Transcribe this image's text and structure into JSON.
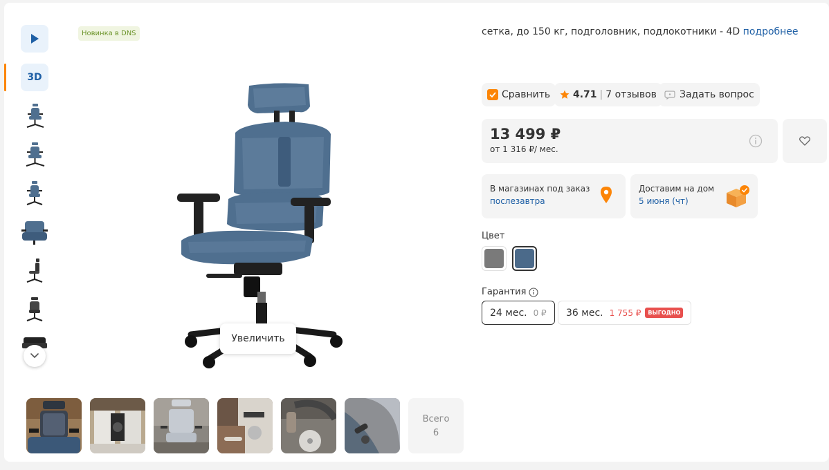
{
  "badge": {
    "new": "Новинка в DNS"
  },
  "thumbnails": {
    "video_icon": "play-icon",
    "label_3d": "3D",
    "images": [
      "chair-front",
      "chair-angle-left",
      "chair-side-front",
      "chair-seat-closeup",
      "chair-profile",
      "chair-back",
      "chair-base"
    ]
  },
  "main_image": {
    "zoom_label": "Увеличить"
  },
  "photos": {
    "items": [
      "user-photo-1",
      "user-photo-2",
      "user-photo-3",
      "user-photo-4",
      "user-photo-5",
      "user-photo-6"
    ],
    "all_label": "Всего",
    "all_count": "6"
  },
  "specs": {
    "text": "сетка, до 150 кг, подголовник, подлокотники - 4D",
    "more_link": "подробнее"
  },
  "actions": {
    "compare_label": "Сравнить",
    "rating": "4.71",
    "separator": "|",
    "reviews": "7 отзывов",
    "ask_label": "Задать вопрос"
  },
  "price": {
    "value": "13 499 ₽",
    "credit": "от 1 316 ₽/ мес."
  },
  "availability": {
    "store_title": "В магазинах под заказ",
    "store_when": "послезавтра",
    "delivery_title": "Доставим на дом",
    "delivery_when": "5 июня (чт)"
  },
  "color": {
    "label": "Цвет",
    "options": [
      {
        "name": "grey",
        "hex": "#7a7a7a",
        "selected": false
      },
      {
        "name": "blue",
        "hex": "#4b6a8a",
        "selected": true
      }
    ]
  },
  "warranty": {
    "label": "Гарантия",
    "options": [
      {
        "term": "24 мес.",
        "price": "0 ₽",
        "selected": true
      },
      {
        "term": "36 мес.",
        "price": "1 755 ₽",
        "badge": "ВЫГОДНО",
        "selected": false
      }
    ]
  },
  "colors": {
    "accent": "#fc8507",
    "link": "#1e5fa5",
    "sale": "#e8504e",
    "chair_mesh": "#4f6f8f"
  }
}
